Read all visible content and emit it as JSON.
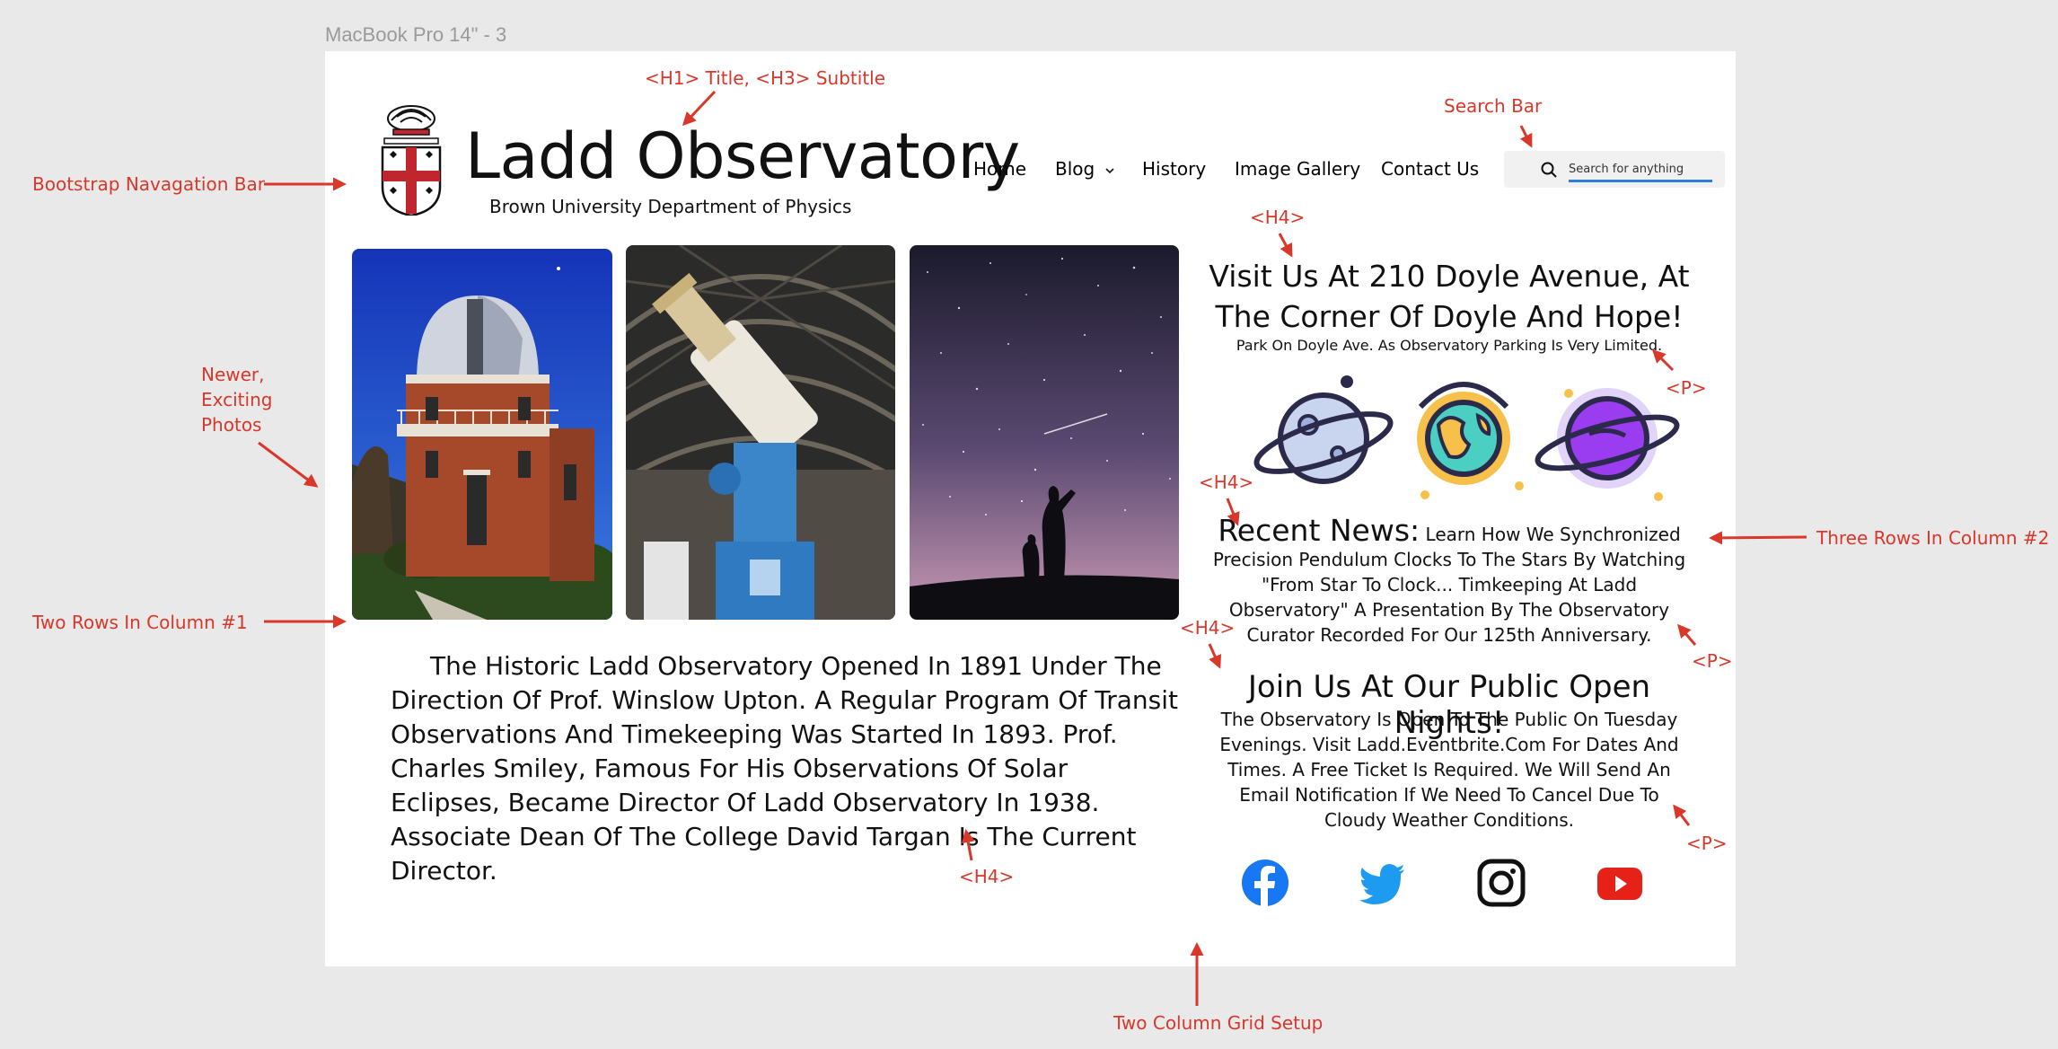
{
  "frame_label": "MacBook Pro 14\" - 3",
  "header": {
    "title": "Ladd Observatory",
    "subtitle": "Brown University Department of Physics",
    "nav": [
      "Home",
      "Blog",
      "History",
      "Image Gallery",
      "Contact Us"
    ],
    "search_placeholder": "Search for anything"
  },
  "photos": [
    "observatory-building",
    "telescope",
    "night-sky-silhouettes"
  ],
  "history_text": "The Historic Ladd Observatory Opened In 1891 Under The Direction Of Prof. Winslow Upton. A Regular Program Of Transit Observations And Timekeeping Was Started In 1893. Prof. Charles Smiley, Famous For His Observations Of Solar Eclipses, Became Director Of Ladd Observatory In 1938. Associate Dean Of The College David Targan Is The Current Director.",
  "visit": {
    "heading": "Visit Us At 210 Doyle Avenue, At The Corner Of Doyle And Hope!",
    "text": "Park On Doyle Ave. As Observatory Parking Is Very Limited."
  },
  "news": {
    "heading": "Recent News:",
    "text": "Learn How We Synchronized Precision Pendulum Clocks To The Stars By Watching \"From Star To Clock... Timkeeping At Ladd Observatory\" A Presentation By The Observatory Curator Recorded For Our 125th Anniversary."
  },
  "open_nights": {
    "heading": "Join Us At Our Public Open Nights!",
    "text": "The Observatory Is Open To The Public On Tuesday Evenings. Visit Ladd.Eventbrite.Com For Dates And Times. A Free Ticket Is Required. We Will Send An Email Notification If We Need To Cancel Due To Cloudy Weather Conditions."
  },
  "social_icons": [
    "facebook-icon",
    "twitter-icon",
    "instagram-icon",
    "youtube-icon"
  ],
  "annotations": {
    "title": "<H1> Title, <H3> Subtitle",
    "search": "Search Bar",
    "navbar": "Bootstrap Navagation Bar",
    "h4_visit": "<H4>",
    "p_visit": "<P>",
    "photos_l1": "Newer,",
    "photos_l2": "Exciting",
    "photos_l3": "Photos",
    "h4_news": "<H4>",
    "three_rows": "Three Rows In Column #2",
    "p_news": "<P>",
    "two_rows": "Two Rows In Column #1",
    "h4_open": "<H4>",
    "p_open": "<P>",
    "h4_history": "<H4>",
    "grid": "Two Column Grid Setup"
  },
  "colors": {
    "annotation": "#d8372a",
    "search_underline": "#2d7ed6",
    "facebook": "#1877f2",
    "twitter": "#1d9bf0",
    "youtube": "#e62117"
  }
}
